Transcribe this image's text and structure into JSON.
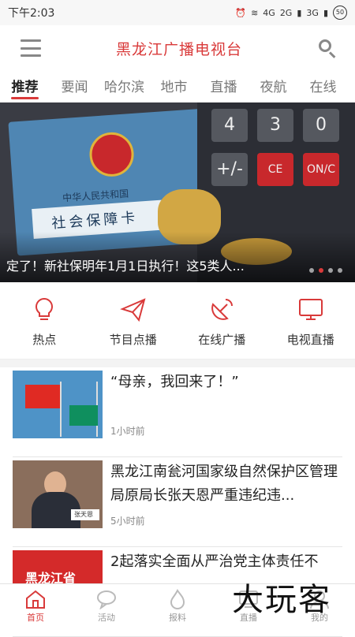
{
  "status_bar": {
    "time": "下午2:03",
    "network_labels": [
      "4G",
      "2G",
      "3G"
    ],
    "battery": "50"
  },
  "header": {
    "title": "黑龙江广播电视台",
    "menu_icon": "hamburger-icon",
    "search_icon": "search-icon"
  },
  "tabs": [
    "推荐",
    "要闻",
    "哈尔滨",
    "地市",
    "直播",
    "夜航",
    "在线"
  ],
  "active_tab": "推荐",
  "banner": {
    "image_texts": [
      "中华人民共和国",
      "社会保障卡"
    ],
    "caption": "定了！新社保明年1月1日执行！这5类人...",
    "slide_count": 4,
    "active_slide": 2
  },
  "quick_links": [
    {
      "label": "热点",
      "icon": "lightbulb-icon"
    },
    {
      "label": "节目点播",
      "icon": "paper-plane-icon"
    },
    {
      "label": "在线广播",
      "icon": "satellite-dish-icon"
    },
    {
      "label": "电视直播",
      "icon": "tv-icon"
    }
  ],
  "news": [
    {
      "title": "“母亲，我回来了！”",
      "time": "1小时前",
      "thumb": "flags"
    },
    {
      "title": "黑龙江南瓮河国家级自然保护区管理局原局长张天恩严重违纪违...",
      "time": "5小时前",
      "thumb": "official",
      "thumb_text": "张天恩"
    },
    {
      "title": "2起落实全面从严治党主体责任不",
      "time": "",
      "thumb": "sign",
      "thumb_text": "黑龙江省"
    }
  ],
  "bottom_nav": [
    {
      "label": "首页",
      "icon": "home-icon",
      "active": true
    },
    {
      "label": "活动",
      "icon": "chat-bubble-icon",
      "active": false
    },
    {
      "label": "报料",
      "icon": "flame-icon",
      "active": false
    },
    {
      "label": "直播",
      "icon": "tv-icon",
      "active": false
    },
    {
      "label": "我的",
      "icon": "user-icon",
      "active": false
    }
  ],
  "watermark": "大玩客",
  "colors": {
    "accent": "#d93a3a",
    "inactive": "#999999"
  }
}
